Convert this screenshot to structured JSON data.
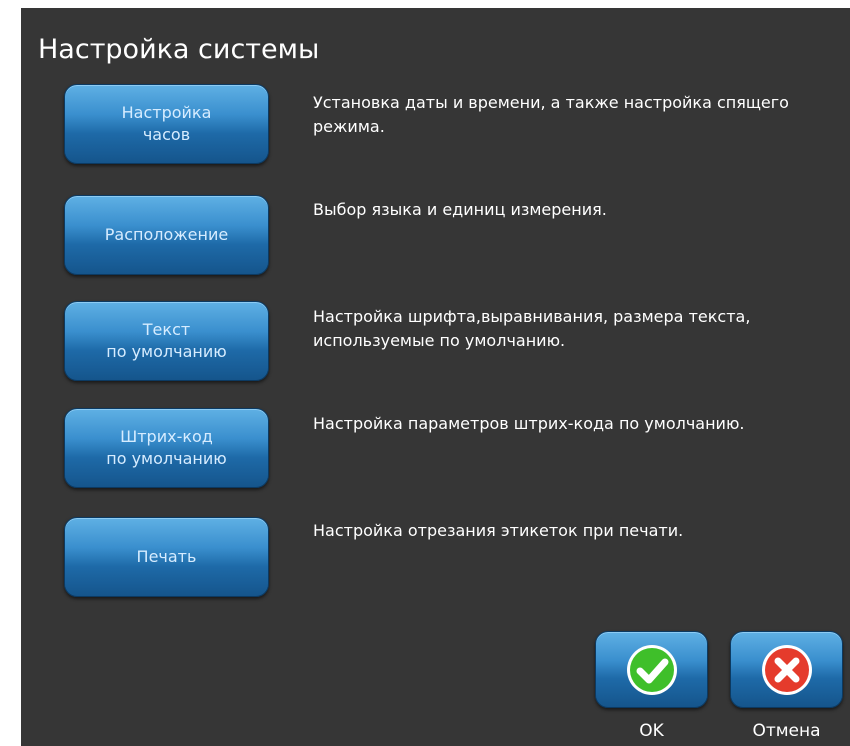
{
  "title": "Настройка системы",
  "settings": [
    {
      "label": "Настройка\nчасов",
      "description": "Установка даты и времени, а также настройка спящего режима."
    },
    {
      "label": "Расположение",
      "description": "Выбор языка и единиц измерения."
    },
    {
      "label": "Текст\nпо умолчанию",
      "description": "Настройка шрифта,выравнивания, размера текста, используемые по умолчанию."
    },
    {
      "label": "Штрих-код\nпо умолчанию",
      "description": "Настройка параметров штрих-кода по умолчанию."
    },
    {
      "label": "Печать",
      "description": "Настройка отрезания этикеток при печати."
    }
  ],
  "actions": {
    "ok": {
      "label": "OK",
      "icon": "check-icon",
      "color": "#3fbf2a"
    },
    "cancel": {
      "label": "Отмена",
      "icon": "close-icon",
      "color": "#e53b2c"
    }
  },
  "colors": {
    "background": "#363636",
    "button_blue": "#2a7cc0"
  }
}
